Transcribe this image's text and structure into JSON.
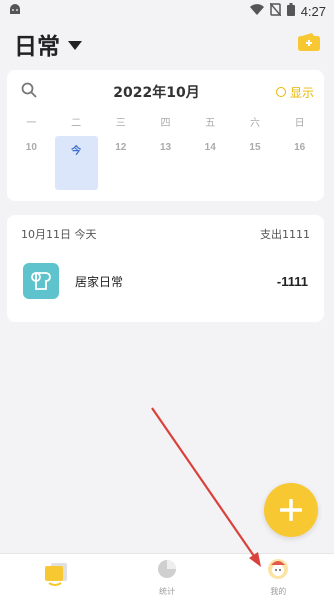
{
  "status_bar": {
    "time": "4:27",
    "icons": [
      "android-icon",
      "wifi-icon",
      "no-sim-icon",
      "battery-icon"
    ]
  },
  "header": {
    "ledger_title": "日常",
    "icons": [
      "dropdown-arrow-icon",
      "wallet-icon"
    ]
  },
  "calendar": {
    "month_title": "2022年10月",
    "show_toggle_label": "显示",
    "weekdays": [
      "一",
      "二",
      "三",
      "四",
      "五",
      "六",
      "日"
    ],
    "days": [
      "10",
      "今",
      "12",
      "13",
      "14",
      "15",
      "16"
    ],
    "today_index": 1
  },
  "records": {
    "date_label": "10月11日 今天",
    "summary_label": "支出1111",
    "entries": [
      {
        "icon": "toilet-paper-icon",
        "name": "居家日常",
        "amount": "-1111"
      }
    ]
  },
  "tabbar": {
    "tabs": [
      {
        "label": "",
        "icon": "ledger-icon",
        "active": true
      },
      {
        "label": "统计",
        "icon": "pie-chart-icon",
        "active": false
      },
      {
        "label": "我的",
        "icon": "avatar-icon",
        "active": false
      }
    ]
  },
  "colors": {
    "accent": "#f7c832",
    "toggle": "#e8b600",
    "today_bg": "#dce6fb",
    "today_text": "#3f6fcf",
    "category_bg": "#5ec3cc",
    "annotation_arrow": "#d9413a"
  }
}
